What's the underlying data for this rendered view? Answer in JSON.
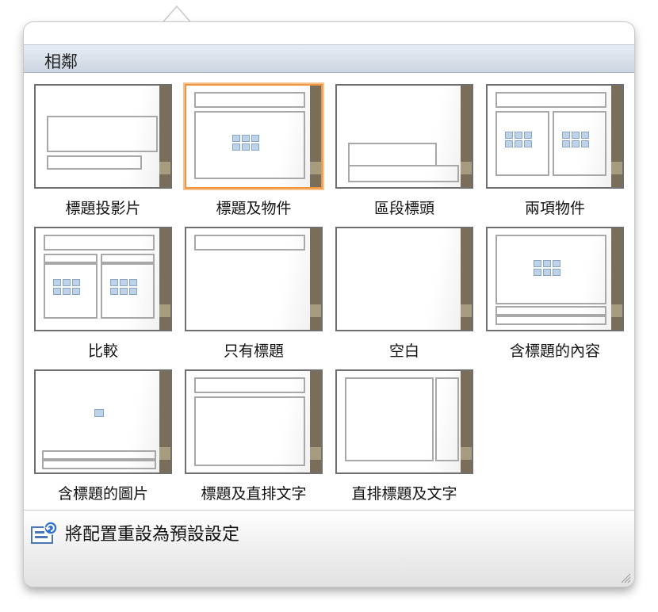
{
  "section": {
    "title": "相鄰"
  },
  "layouts": [
    {
      "label": "標題投影片"
    },
    {
      "label": "標題及物件"
    },
    {
      "label": "區段標頭"
    },
    {
      "label": "兩項物件"
    },
    {
      "label": "比較"
    },
    {
      "label": "只有標題"
    },
    {
      "label": "空白"
    },
    {
      "label": "含標題的內容"
    },
    {
      "label": "含標題的圖片"
    },
    {
      "label": "標題及直排文字"
    },
    {
      "label": "直排標題及文字"
    }
  ],
  "footer": {
    "reset_label": "將配置重設為預設設定"
  },
  "colors": {
    "selected_border": "#ef9640",
    "side_bar": "#7a6e5a",
    "header_bg": "#cbd5e1"
  }
}
